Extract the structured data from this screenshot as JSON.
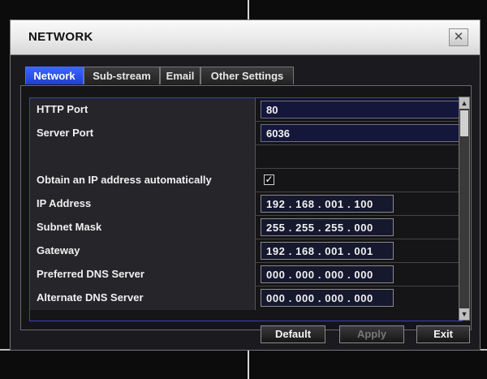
{
  "dialog": {
    "title": "NETWORK",
    "close_icon": "close-icon"
  },
  "tabs": [
    {
      "label": "Network",
      "active": true
    },
    {
      "label": "Sub-stream",
      "active": false
    },
    {
      "label": "Email",
      "active": false
    },
    {
      "label": "Other Settings",
      "active": false
    }
  ],
  "rows": {
    "http_port": {
      "label": "HTTP Port",
      "value": "80"
    },
    "server_port": {
      "label": "Server Port",
      "value": "6036"
    },
    "obtain_ip": {
      "label": "Obtain an IP address automatically",
      "checked": true,
      "check_glyph": "✓"
    },
    "ip_address": {
      "label": "IP Address",
      "value": "192 . 168 . 001 . 100"
    },
    "subnet_mask": {
      "label": "Subnet Mask",
      "value": "255 . 255 . 255 . 000"
    },
    "gateway": {
      "label": "Gateway",
      "value": "192 . 168 . 001 . 001"
    },
    "preferred_dns": {
      "label": "Preferred DNS Server",
      "value": "000 . 000 . 000 . 000"
    },
    "alternate_dns": {
      "label": "Alternate DNS Server",
      "value": "000 . 000 . 000 . 000"
    }
  },
  "buttons": {
    "default_label": "Default",
    "apply_label": "Apply",
    "exit_label": "Exit"
  },
  "scrollbar": {
    "up_glyph": "▲",
    "down_glyph": "▼"
  },
  "colors": {
    "active_tab": "#2f55f0",
    "background": "#0c0c0c",
    "field_fill": "#14163a"
  }
}
